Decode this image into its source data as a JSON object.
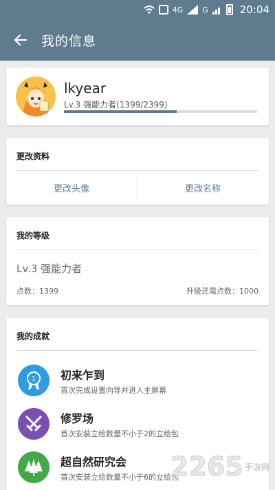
{
  "status_bar": {
    "network": "4G",
    "network2": "G",
    "time": "20:04"
  },
  "app_bar": {
    "title": "我的信息",
    "back_icon": "arrow-left-icon"
  },
  "profile": {
    "username": "lkyear",
    "level_text": "Lv.3 强能力者(1399/2399)",
    "progress": 0.583
  },
  "edit_card": {
    "title": "更改资料",
    "change_avatar": "更改头像",
    "change_name": "更改名称"
  },
  "level_card": {
    "title": "我的等级",
    "level_name": "Lv.3 强能力者",
    "points": "点数：1399",
    "next_level": "升级还需点数：1000"
  },
  "achievements": {
    "title": "我的成就",
    "items": [
      {
        "name": "初来乍到",
        "desc": "首次完成设置向导并进入主屏幕",
        "icon": "medal-icon",
        "color": "#2f9be0"
      },
      {
        "name": "修罗场",
        "desc": "首次安装立绘数量不小于2的立绘包",
        "icon": "crossed-swords-icon",
        "color": "#7b4fb3"
      },
      {
        "name": "超自然研究会",
        "desc": "首次安装立绘数量不小于6的立绘包",
        "icon": "forest-icon",
        "color": "#43a84a"
      }
    ]
  },
  "watermark": {
    "number": "2265",
    "suffix": "手游网"
  }
}
